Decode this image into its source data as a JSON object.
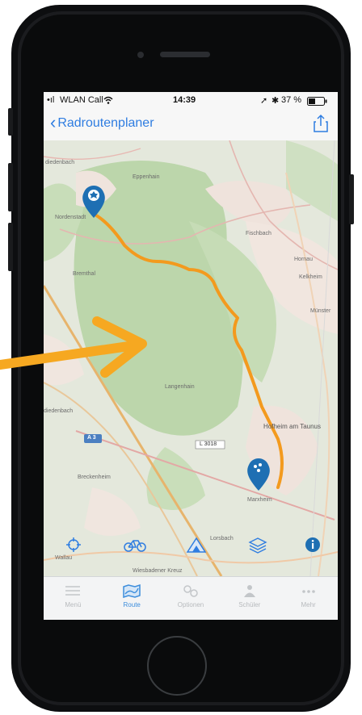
{
  "statusbar": {
    "carrier": "WLAN Call",
    "time": "14:39",
    "battery": "37 %"
  },
  "navbar": {
    "back_label": "Radroutenplaner"
  },
  "map": {
    "labels": {
      "nordenstadt": "Nordenstadt",
      "eppenhain": "Eppenhain",
      "fischbach": "Fischbach",
      "kelkheim": "Kelkheim",
      "bremthal": "Bremthal",
      "langenhain": "Langenhain",
      "diedenbach": "diedenbach",
      "a3": "A 3",
      "l3018": "L 3018",
      "hofheim": "Hofheim am Taunus",
      "marxheim": "Marxheim",
      "breckenheim": "Breckenheim",
      "lorsbach": "Lorsbach",
      "wallau": "Wallau",
      "wiesbadener_kreuz": "Wiesbadener Kreuz",
      "munster": "Münster",
      "hornau": "Hornau"
    },
    "route_color": "#f39a1e",
    "arrow_color": "#f6a821",
    "pin_color": "#1e6fb3",
    "start_pin_icon": "flower-icon",
    "end_pin_icon": "bike-group-icon"
  },
  "tools": [
    {
      "name": "locate-icon"
    },
    {
      "name": "bike-icon"
    },
    {
      "name": "elevation-icon"
    },
    {
      "name": "layers-icon"
    },
    {
      "name": "info-icon"
    }
  ],
  "tabs": [
    {
      "label": "Menü",
      "icon": "menu-icon"
    },
    {
      "label": "Route",
      "icon": "route-map-icon"
    },
    {
      "label": "Optionen",
      "icon": "options-icon"
    },
    {
      "label": "Schüler",
      "icon": "student-icon"
    },
    {
      "label": "Mehr",
      "icon": "more-icon"
    }
  ]
}
